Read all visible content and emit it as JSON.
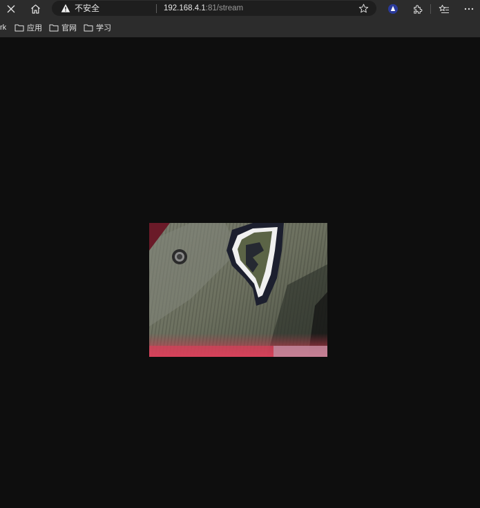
{
  "toolbar": {
    "close_icon": "close-icon",
    "home_icon": "home-icon",
    "address": {
      "security_label": "不安全",
      "url_host": "192.168.4.1",
      "url_rest": ":81/stream"
    },
    "favorite_icon": "star-icon",
    "extensions_icon": "puzzle-icon",
    "favorites_list_icon": "favorites-list-icon",
    "more_icon": "more-icon"
  },
  "bookmarks": {
    "cut_label": "rk",
    "items": [
      {
        "label": "应用"
      },
      {
        "label": "官网"
      },
      {
        "label": "学习"
      }
    ]
  },
  "content": {
    "stream_description_icon": "camera-stream-image"
  },
  "colors": {
    "toolbar_bg": "#2c2c2c",
    "page_bg": "#0e0e0e",
    "address_bg": "#1e1e1e",
    "profile_accent": "#2a3a9a"
  }
}
